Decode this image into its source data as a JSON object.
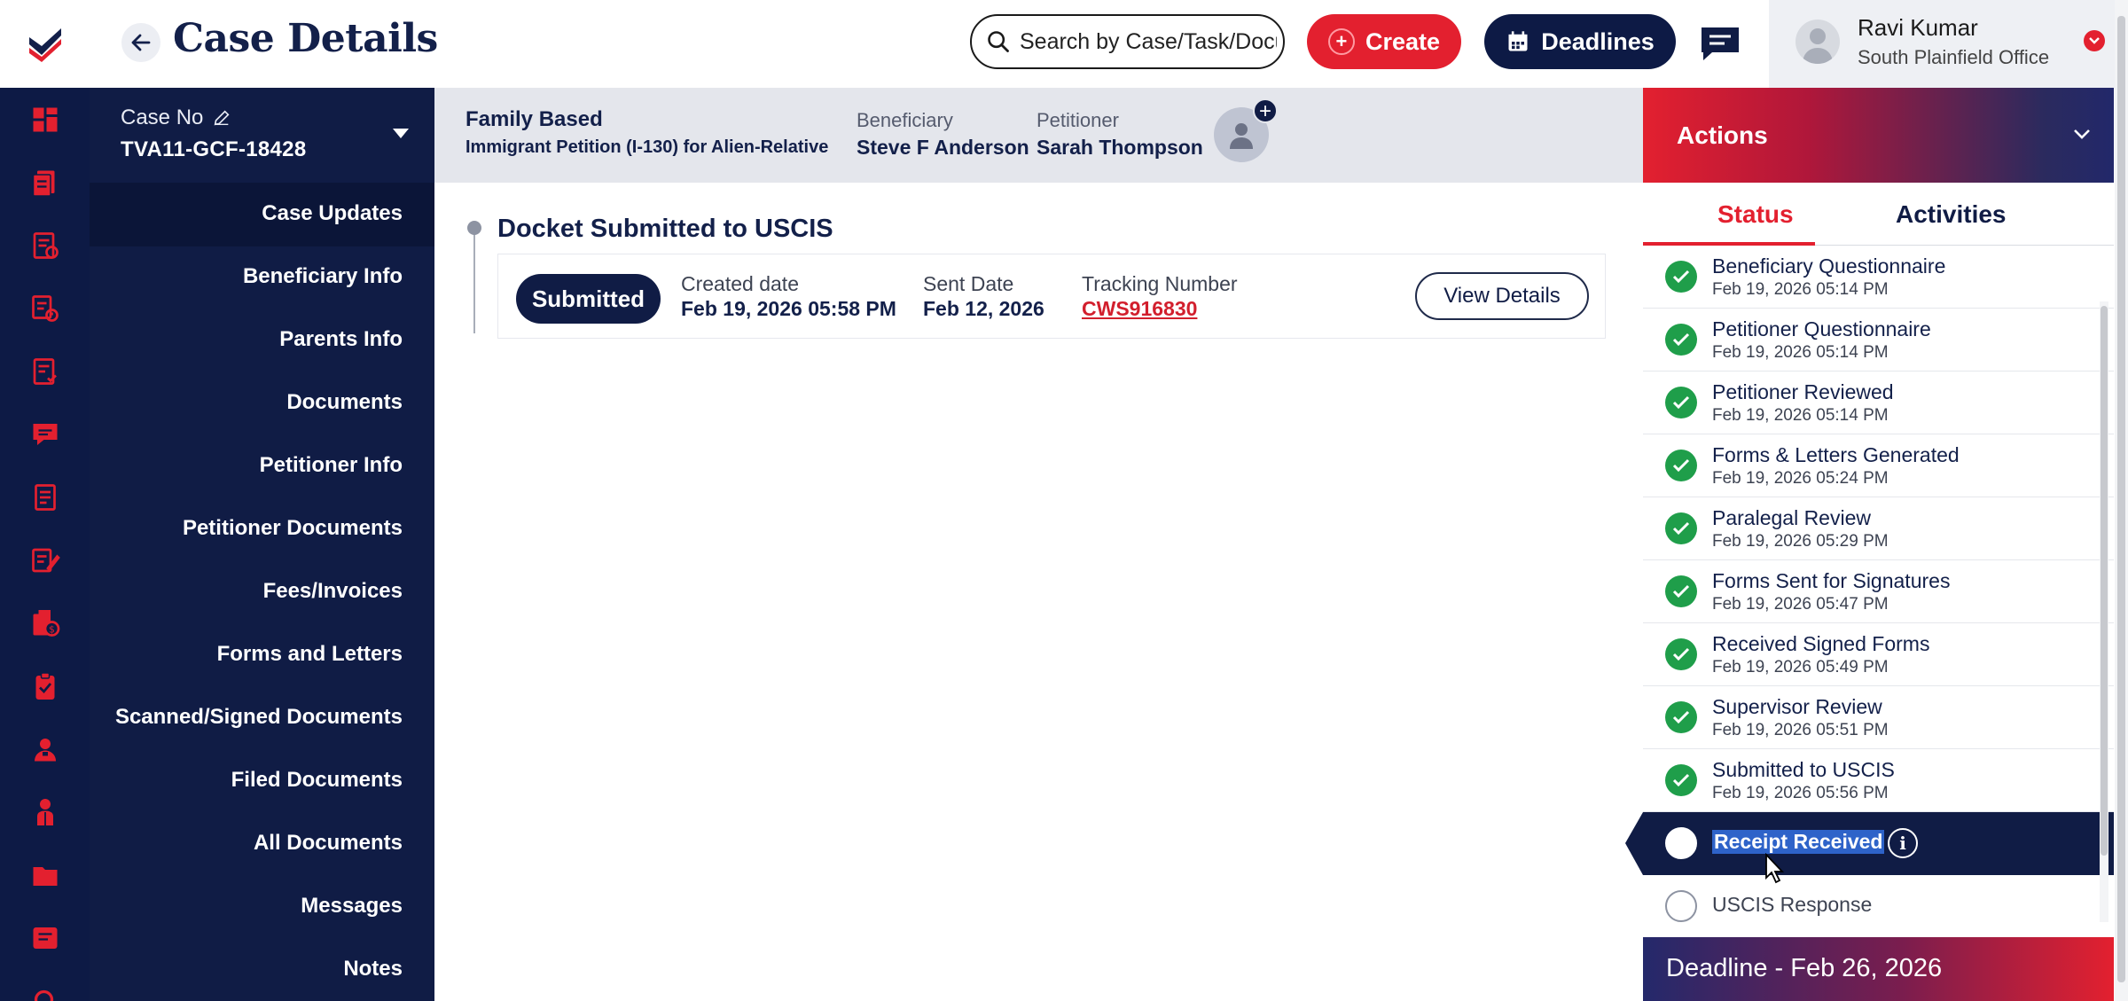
{
  "header": {
    "title": "Case Details",
    "search_placeholder": "Search by Case/Task/Document",
    "create_label": "Create",
    "deadlines_label": "Deadlines",
    "user_name": "Ravi Kumar",
    "user_office": "South Plainfield Office"
  },
  "case": {
    "case_no_label": "Case No",
    "case_no": "TVA11-GCF-18428",
    "type": "Family Based",
    "form": "Immigrant Petition (I-130) for Alien-Relative",
    "beneficiary_label": "Beneficiary",
    "beneficiary": "Steve F Anderson",
    "petitioner_label": "Petitioner",
    "petitioner": "Sarah Thompson"
  },
  "nav": {
    "items": [
      {
        "label": "Case Updates"
      },
      {
        "label": "Beneficiary Info"
      },
      {
        "label": "Parents Info"
      },
      {
        "label": "Documents"
      },
      {
        "label": "Petitioner Info"
      },
      {
        "label": "Petitioner Documents"
      },
      {
        "label": "Fees/Invoices"
      },
      {
        "label": "Forms and Letters"
      },
      {
        "label": "Scanned/Signed Documents"
      },
      {
        "label": "Filed Documents"
      },
      {
        "label": "All Documents"
      },
      {
        "label": "Messages"
      },
      {
        "label": "Notes"
      }
    ]
  },
  "docket": {
    "title": "Docket Submitted to USCIS",
    "status": "Submitted",
    "created_label": "Created date",
    "created_value": "Feb 19, 2026 05:58 PM",
    "sent_label": "Sent Date",
    "sent_value": "Feb 12, 2026",
    "tracking_label": "Tracking Number",
    "tracking_value": "CWS916830",
    "view_label": "View Details"
  },
  "actions": {
    "title": "Actions",
    "tab_status": "Status",
    "tab_activities": "Activities",
    "steps": [
      {
        "title": "Beneficiary Questionnaire",
        "date": "Feb 19, 2026 05:14 PM"
      },
      {
        "title": "Petitioner Questionnaire",
        "date": "Feb 19, 2026 05:14 PM"
      },
      {
        "title": "Petitioner Reviewed",
        "date": "Feb 19, 2026 05:14 PM"
      },
      {
        "title": "Forms & Letters Generated",
        "date": "Feb 19, 2026 05:24 PM"
      },
      {
        "title": "Paralegal Review",
        "date": "Feb 19, 2026 05:29 PM"
      },
      {
        "title": "Forms Sent for Signatures",
        "date": "Feb 19, 2026 05:47 PM"
      },
      {
        "title": "Received Signed Forms",
        "date": "Feb 19, 2026 05:49 PM"
      },
      {
        "title": "Supervisor Review",
        "date": "Feb 19, 2026 05:51 PM"
      },
      {
        "title": "Submitted to USCIS",
        "date": "Feb 19, 2026 05:56 PM"
      },
      {
        "title": "Receipt Received",
        "date": ""
      },
      {
        "title": "USCIS Response",
        "date": ""
      }
    ],
    "deadline": "Deadline - Feb 26, 2026"
  },
  "colors": {
    "navy": "#101c45",
    "brand_red": "#e3202f",
    "success_green": "#1f9e4a"
  },
  "icons": {
    "rail": [
      "dashboard-icon",
      "cases-icon",
      "case-list-icon",
      "tasks-icon",
      "reports-icon",
      "messages-icon",
      "documents-icon",
      "forms-icon",
      "billing-icon",
      "clipboard-icon",
      "user-icon",
      "person-icon",
      "folder-icon",
      "notes-icon",
      "search-icon"
    ]
  }
}
